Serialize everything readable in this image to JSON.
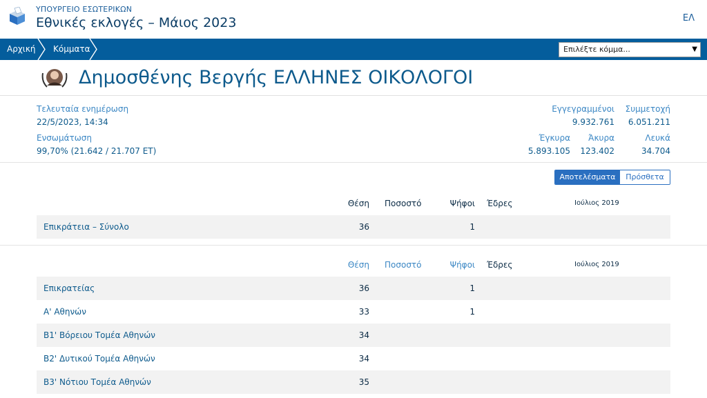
{
  "header": {
    "ministry": "ΥΠΟΥΡΓΕΙΟ ΕΣΩΤΕΡΙΚΩΝ",
    "title": "Εθνικές εκλογές – Μάιος 2023",
    "language": "ΕΛ"
  },
  "nav": {
    "breadcrumbs": [
      "Αρχική",
      "Κόμματα"
    ],
    "party_select": {
      "value": "Επιλέξτε κόμμα..."
    }
  },
  "candidate": {
    "name": "Δημοσθένης Βεργής ΕΛΛΗΝΕΣ ΟΙΚΟΛΟΓΟΙ"
  },
  "stats": {
    "last_update_label": "Τελευταία ενημέρωση",
    "last_update_value": "22/5/2023, 14:34",
    "integration_label": "Ενσωμάτωση",
    "integration_value": "99,70% (21.642 / 21.707 ΕΤ)",
    "registered_label": "Εγγεγραμμένοι",
    "registered_value": "9.932.761",
    "turnout_label": "Συμμετοχή",
    "turnout_value": "6.051.211",
    "valid_label": "Έγκυρα",
    "valid_value": "5.893.105",
    "invalid_label": "Άκυρα",
    "invalid_value": "123.402",
    "blank_label": "Λευκά",
    "blank_value": "34.704"
  },
  "toggle": {
    "active": "Αποτελέσματα",
    "inactive": "Πρόσθετα"
  },
  "table1": {
    "headers": {
      "position": "Θέση",
      "percent": "Ποσοστό",
      "votes": "Ψήφοι",
      "seats": "Έδρες",
      "period": "Ιούλιος 2019"
    },
    "rows": [
      {
        "name": "Επικράτεια – Σύνολο",
        "position": "36",
        "votes": "1"
      }
    ]
  },
  "table2": {
    "headers": {
      "position": "Θέση",
      "percent": "Ποσοστό",
      "votes": "Ψήφοι",
      "seats": "Έδρες",
      "period": "Ιούλιος 2019"
    },
    "rows": [
      {
        "name": "Επικρατείας",
        "position": "36",
        "votes": "1"
      },
      {
        "name": "Α' Αθηνών",
        "position": "33",
        "votes": "1"
      },
      {
        "name": "Β1' Βόρειου Τομέα Αθηνών",
        "position": "34",
        "votes": ""
      },
      {
        "name": "Β2' Δυτικού Τομέα Αθηνών",
        "position": "34",
        "votes": ""
      },
      {
        "name": "Β3' Νότιου Τομέα Αθηνών",
        "position": "35",
        "votes": ""
      }
    ]
  },
  "colors": {
    "navbar": "#045d9c",
    "accent": "#2a6fc0",
    "row_shade": "#f2f2f2"
  }
}
